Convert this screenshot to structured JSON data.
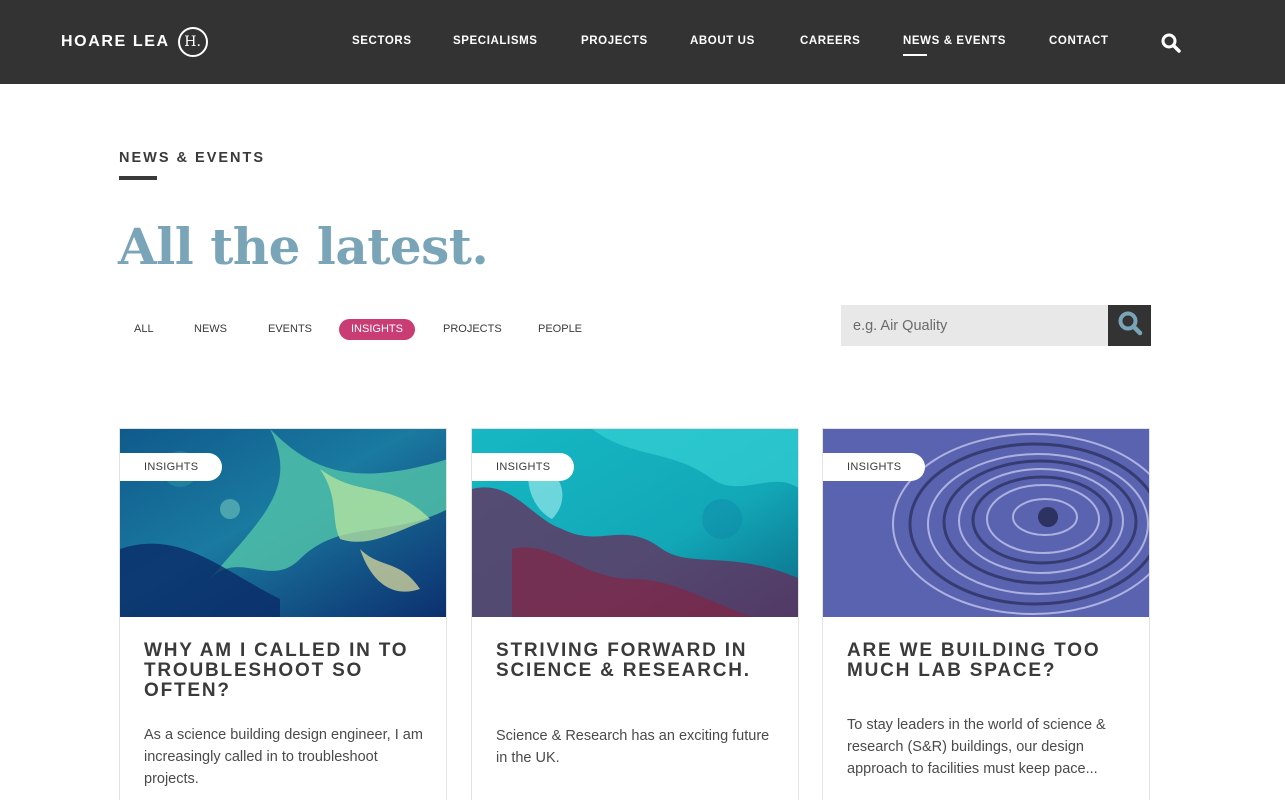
{
  "header": {
    "logo_text": "HOARE LEA",
    "logo_mark": "H.",
    "nav": [
      {
        "label": "SECTORS"
      },
      {
        "label": "SPECIALISMS"
      },
      {
        "label": "PROJECTS"
      },
      {
        "label": "ABOUT US"
      },
      {
        "label": "CAREERS"
      },
      {
        "label": "NEWS & EVENTS",
        "active": true
      },
      {
        "label": "CONTACT"
      }
    ],
    "search_icon": "search-icon"
  },
  "section": {
    "eyebrow": "NEWS & EVENTS",
    "headline": "All the latest."
  },
  "filters": [
    {
      "label": "ALL"
    },
    {
      "label": "NEWS"
    },
    {
      "label": "EVENTS"
    },
    {
      "label": "INSIGHTS",
      "active": true
    },
    {
      "label": "PROJECTS"
    },
    {
      "label": "PEOPLE"
    }
  ],
  "search": {
    "placeholder": "e.g. Air Quality",
    "button_icon": "search-icon"
  },
  "cards": [
    {
      "tag": "INSIGHTS",
      "title": "WHY AM I CALLED IN TO TROUBLESHOOT SO OFTEN?",
      "body": "As a science building design engineer, I am increasingly called in to troubleshoot projects."
    },
    {
      "tag": "INSIGHTS",
      "title": "STRIVING FORWARD IN SCIENCE & RESEARCH.",
      "body": "Science & Research has an exciting future in the UK."
    },
    {
      "tag": "INSIGHTS",
      "title": "ARE WE BUILDING TOO MUCH LAB SPACE?",
      "body": "To stay leaders in the world of science & research (S&R) buildings, our design approach to facilities must keep pace..."
    }
  ],
  "colors": {
    "header_bg": "#333333",
    "headline": "#7aa4b8",
    "accent_pink": "#c93d74"
  }
}
